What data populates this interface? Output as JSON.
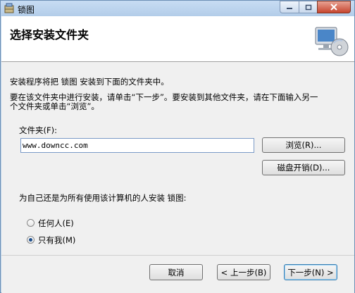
{
  "window": {
    "title": "锁图",
    "icon": "installer-app-icon"
  },
  "header": {
    "title": "选择安装文件夹",
    "icon": "computer-cd-icon"
  },
  "content": {
    "intro": "安装程序将把 锁图 安装到下面的文件夹中。",
    "instructions_line1": "要在该文件夹中进行安装，请单击“下一步”。要安装到其他文件夹，请在下面输入另一",
    "instructions_line2": "个文件夹或单击“浏览”。",
    "folder_label": "文件夹(F):",
    "folder_value": "www.downcc.com",
    "browse_label": "浏览(R)...",
    "disk_cost_label": "磁盘开销(D)...",
    "install_for_label": "为自己还是为所有使用该计算机的人安装 锁图:",
    "options": [
      {
        "label": "任何人(E)",
        "selected": false
      },
      {
        "label": "只有我(M)",
        "selected": true
      }
    ]
  },
  "footer": {
    "cancel_label": "取消",
    "back_label": "< 上一步(B)",
    "next_label": "下一步(N) >"
  }
}
